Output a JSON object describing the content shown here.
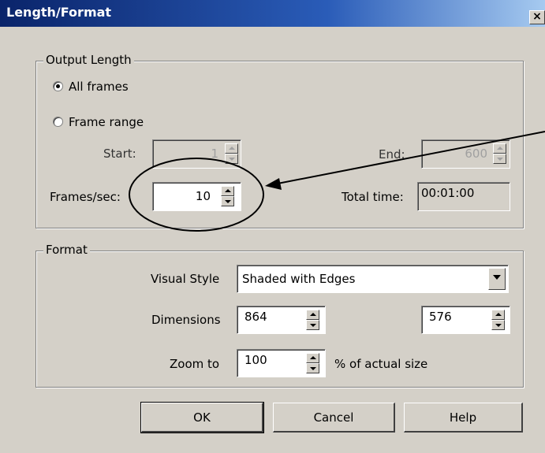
{
  "window": {
    "title": "Length/Format",
    "close_glyph": "×"
  },
  "output_length": {
    "legend": "Output Length",
    "all_frames_label": "All frames",
    "frame_range_label": "Frame range",
    "selected": "All frames",
    "start_label": "Start:",
    "start_value": "1",
    "end_label": "End:",
    "end_value": "600",
    "fps_label": "Frames/sec:",
    "fps_value": "10",
    "total_time_label": "Total time:",
    "total_time_value": "00:01:00"
  },
  "format": {
    "legend": "Format",
    "visual_style_label": "Visual Style",
    "visual_style_value": "Shaded with Edges",
    "dimensions_label": "Dimensions",
    "width_value": "864",
    "height_value": "576",
    "zoom_label": "Zoom to",
    "zoom_value": "100",
    "zoom_suffix": "% of actual size"
  },
  "buttons": {
    "ok": "OK",
    "cancel": "Cancel",
    "help": "Help"
  },
  "annotation": {
    "color": "#000000",
    "shapes": [
      "ellipse",
      "arrow"
    ]
  }
}
